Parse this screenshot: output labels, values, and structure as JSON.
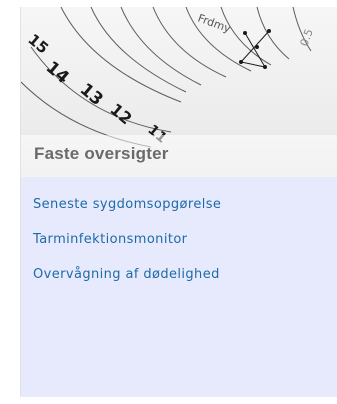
{
  "panel": {
    "title": "Faste oversigter",
    "links": [
      {
        "label": "Seneste sygdomsopgørelse"
      },
      {
        "label": "Tarminfektionsmonitor"
      },
      {
        "label": "Overvågning af dødelighed"
      }
    ]
  },
  "header_image": {
    "ruler_numbers": [
      "15",
      "14",
      "13",
      "12",
      "11"
    ],
    "corner_text": "0.5",
    "top_text": "Frdmy"
  },
  "colors": {
    "panel_background": "#e7eafd",
    "link": "#1f6aa8",
    "title": "#6a6a6a"
  }
}
